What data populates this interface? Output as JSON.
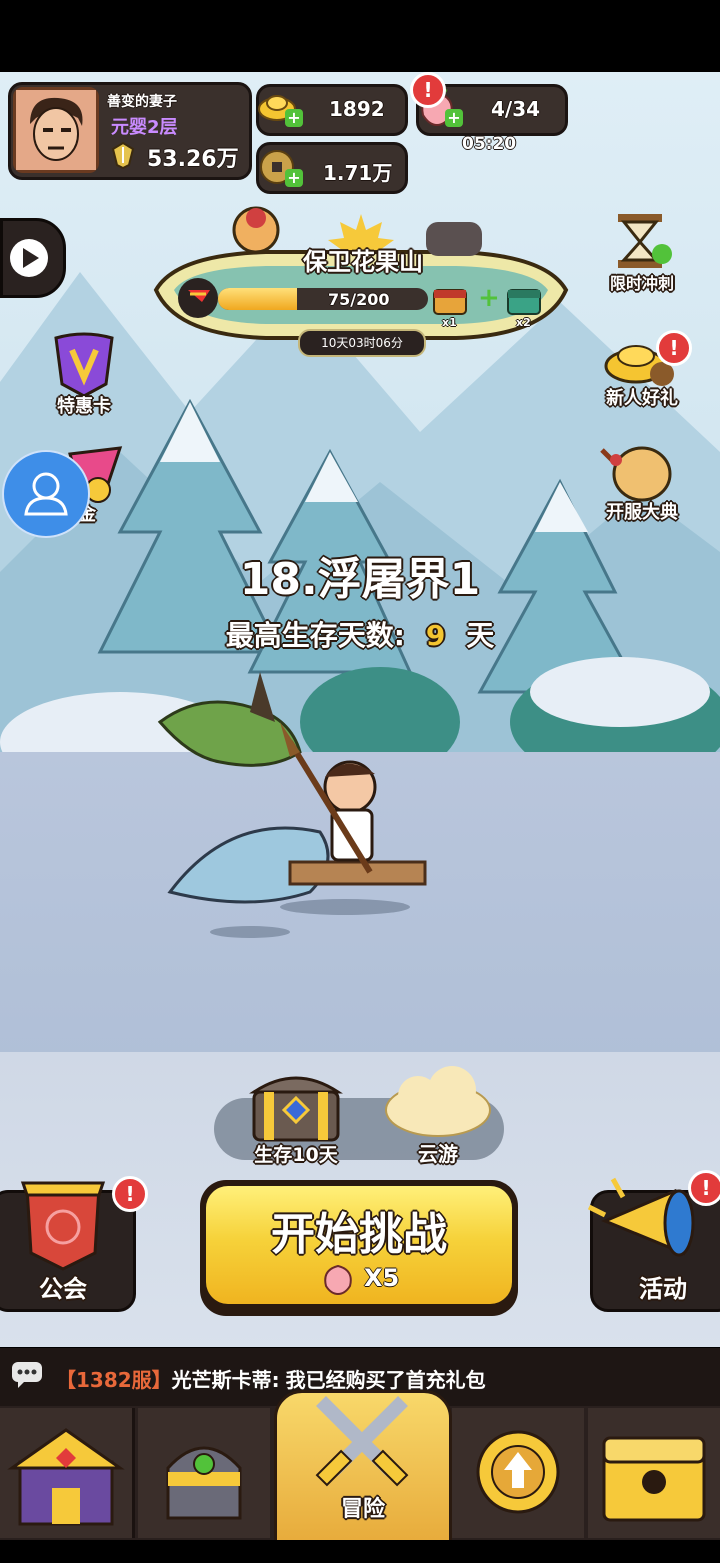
{
  "player": {
    "name": "善变的妻子",
    "realm": "元婴2层",
    "power": "53.26万"
  },
  "resources": {
    "gold_ingot": "1892",
    "coins": "1.71万",
    "stamina": "4/34",
    "stamina_timer": "05:20"
  },
  "event": {
    "title": "保卫花果山",
    "progress_text": "75/200",
    "progress": 0.375,
    "reward1_count": "x1",
    "reward2_count": "x2",
    "countdown": "10天03时06分"
  },
  "left_buttons": {
    "special_card": "特惠卡",
    "partial_label": "金"
  },
  "right_buttons": {
    "sprint": "限时冲刺",
    "newbie_gift": "新人好礼",
    "server_celebration": "开服大典"
  },
  "stage": {
    "name": "18.浮屠界1",
    "best_label": "最高生存天数:",
    "best_days": "9",
    "days_unit": "天"
  },
  "rewards_bar": {
    "chest_label": "生存10天",
    "cloud_label": "云游"
  },
  "main_actions": {
    "guild": "公会",
    "start": "开始挑战",
    "cost": "X5",
    "activity": "活动"
  },
  "chat": {
    "server": "【1382服】",
    "speaker": "光芒斯卡蒂:",
    "message": "我已经购买了首充礼包"
  },
  "bottom_nav": {
    "adventure": "冒险"
  },
  "colors": {
    "accent_yellow": "#f6c93a",
    "panel_dark": "#3a302c",
    "badge_red": "#e23b3b",
    "stage_highlight": "#f3c531"
  }
}
